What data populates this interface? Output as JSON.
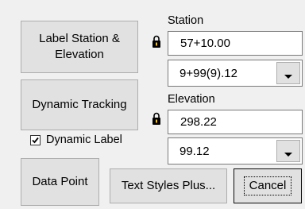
{
  "buttons": {
    "label_station_elevation": [
      "Label Station &",
      "Elevation"
    ],
    "dynamic_tracking": "Dynamic Tracking",
    "data_point": "Data Point",
    "text_styles_plus": "Text Styles Plus...",
    "cancel": "Cancel"
  },
  "station": {
    "label": "Station",
    "value": "57+10.00",
    "combo_value": "9+99(9).12"
  },
  "elevation": {
    "label": "Elevation",
    "value": "298.22",
    "combo_value": "99.12"
  },
  "dynamic_label": {
    "label": "Dynamic Label",
    "checked": true
  },
  "icons": [
    "padlock-icon",
    "chevron-down-icon",
    "checkmark-icon"
  ]
}
